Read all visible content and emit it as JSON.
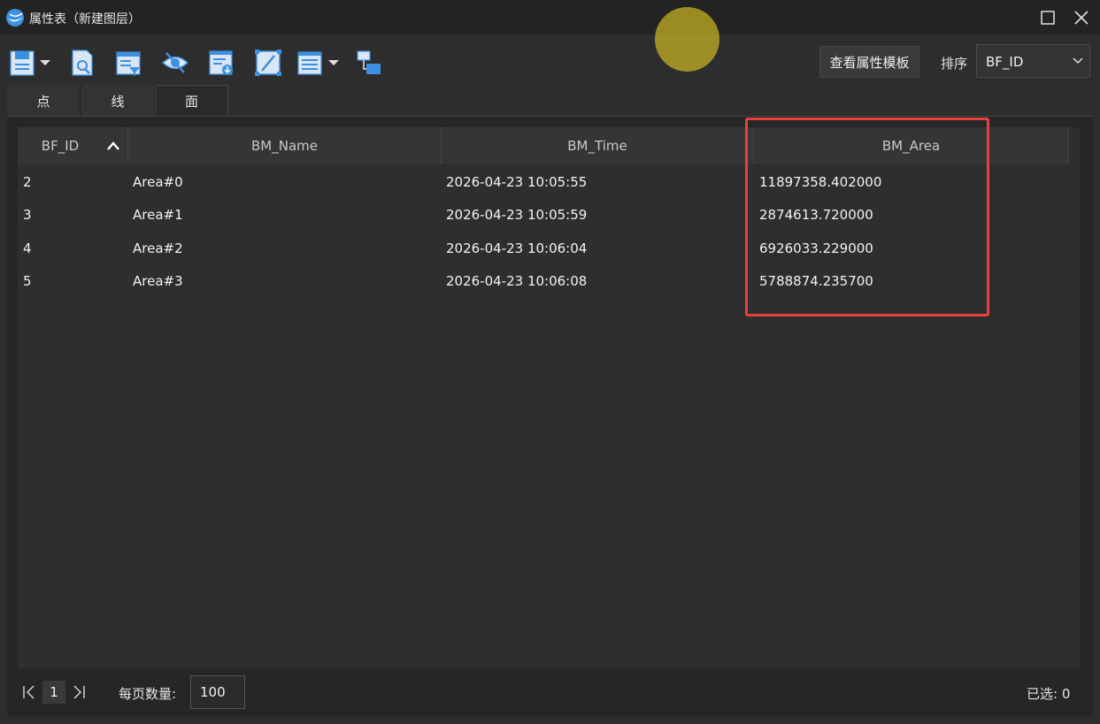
{
  "window": {
    "title": "属性表（新建图层）"
  },
  "toolbar": {
    "template_button": "查看属性模板",
    "sort_label": "排序",
    "sort_value": "BF_ID",
    "icons": [
      "save-icon",
      "dropdown-arrow-icon",
      "preview-icon",
      "filter-icon",
      "hide-icon",
      "export-icon",
      "edit-icon",
      "list-menu-icon",
      "dropdown-arrow-icon",
      "layers-icon"
    ]
  },
  "tabs": [
    {
      "label": "点",
      "active": false
    },
    {
      "label": "线",
      "active": false
    },
    {
      "label": "面",
      "active": true
    }
  ],
  "table": {
    "columns": [
      "BF_ID",
      "BM_Name",
      "BM_Time",
      "BM_Area"
    ],
    "sorted_column": "BF_ID",
    "sort_direction": "ascending",
    "rows": [
      {
        "BF_ID": "2",
        "BM_Name": "Area#0",
        "BM_Time": "2026-04-23 10:05:55",
        "BM_Area": "11897358.402000"
      },
      {
        "BF_ID": "3",
        "BM_Name": "Area#1",
        "BM_Time": "2026-04-23 10:05:59",
        "BM_Area": "2874613.720000"
      },
      {
        "BF_ID": "4",
        "BM_Name": "Area#2",
        "BM_Time": "2026-04-23 10:06:04",
        "BM_Area": "6926033.229000"
      },
      {
        "BF_ID": "5",
        "BM_Name": "Area#3",
        "BM_Time": "2026-04-23 10:06:08",
        "BM_Area": "5788874.235700"
      }
    ]
  },
  "footer": {
    "current_page": "1",
    "per_page_label": "每页数量:",
    "per_page_value": "100",
    "selected_label": "已选: 0"
  },
  "colors": {
    "highlight_box": "#e8403f",
    "cursor_highlight": "#c9b623",
    "accent": "#3d8fe0"
  }
}
